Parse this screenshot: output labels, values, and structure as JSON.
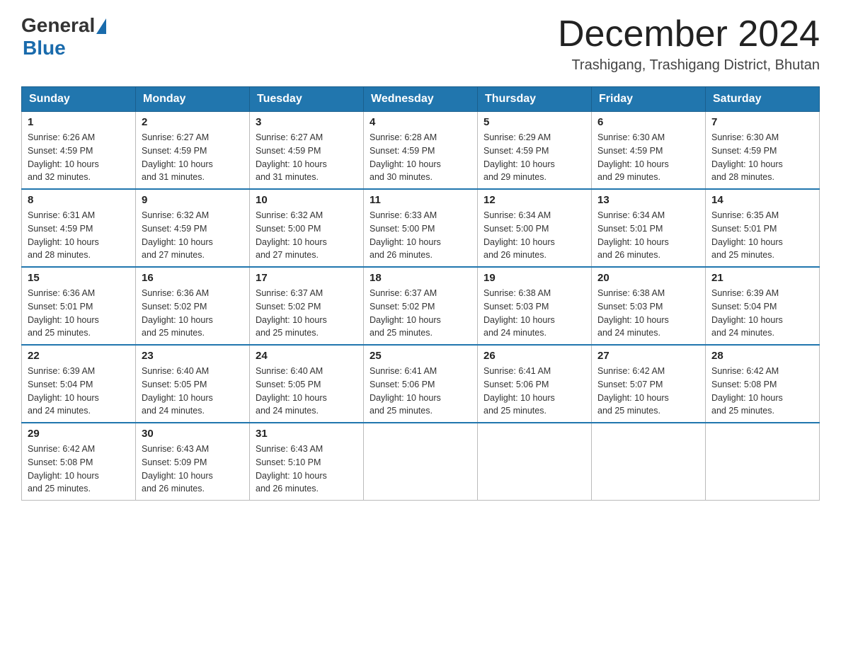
{
  "header": {
    "logo_general": "General",
    "logo_blue": "Blue",
    "month_year": "December 2024",
    "location": "Trashigang, Trashigang District, Bhutan"
  },
  "days_of_week": [
    "Sunday",
    "Monday",
    "Tuesday",
    "Wednesday",
    "Thursday",
    "Friday",
    "Saturday"
  ],
  "weeks": [
    [
      {
        "day": "1",
        "sunrise": "6:26 AM",
        "sunset": "4:59 PM",
        "daylight_hours": "10 hours",
        "daylight_minutes": "and 32 minutes."
      },
      {
        "day": "2",
        "sunrise": "6:27 AM",
        "sunset": "4:59 PM",
        "daylight_hours": "10 hours",
        "daylight_minutes": "and 31 minutes."
      },
      {
        "day": "3",
        "sunrise": "6:27 AM",
        "sunset": "4:59 PM",
        "daylight_hours": "10 hours",
        "daylight_minutes": "and 31 minutes."
      },
      {
        "day": "4",
        "sunrise": "6:28 AM",
        "sunset": "4:59 PM",
        "daylight_hours": "10 hours",
        "daylight_minutes": "and 30 minutes."
      },
      {
        "day": "5",
        "sunrise": "6:29 AM",
        "sunset": "4:59 PM",
        "daylight_hours": "10 hours",
        "daylight_minutes": "and 29 minutes."
      },
      {
        "day": "6",
        "sunrise": "6:30 AM",
        "sunset": "4:59 PM",
        "daylight_hours": "10 hours",
        "daylight_minutes": "and 29 minutes."
      },
      {
        "day": "7",
        "sunrise": "6:30 AM",
        "sunset": "4:59 PM",
        "daylight_hours": "10 hours",
        "daylight_minutes": "and 28 minutes."
      }
    ],
    [
      {
        "day": "8",
        "sunrise": "6:31 AM",
        "sunset": "4:59 PM",
        "daylight_hours": "10 hours",
        "daylight_minutes": "and 28 minutes."
      },
      {
        "day": "9",
        "sunrise": "6:32 AM",
        "sunset": "4:59 PM",
        "daylight_hours": "10 hours",
        "daylight_minutes": "and 27 minutes."
      },
      {
        "day": "10",
        "sunrise": "6:32 AM",
        "sunset": "5:00 PM",
        "daylight_hours": "10 hours",
        "daylight_minutes": "and 27 minutes."
      },
      {
        "day": "11",
        "sunrise": "6:33 AM",
        "sunset": "5:00 PM",
        "daylight_hours": "10 hours",
        "daylight_minutes": "and 26 minutes."
      },
      {
        "day": "12",
        "sunrise": "6:34 AM",
        "sunset": "5:00 PM",
        "daylight_hours": "10 hours",
        "daylight_minutes": "and 26 minutes."
      },
      {
        "day": "13",
        "sunrise": "6:34 AM",
        "sunset": "5:01 PM",
        "daylight_hours": "10 hours",
        "daylight_minutes": "and 26 minutes."
      },
      {
        "day": "14",
        "sunrise": "6:35 AM",
        "sunset": "5:01 PM",
        "daylight_hours": "10 hours",
        "daylight_minutes": "and 25 minutes."
      }
    ],
    [
      {
        "day": "15",
        "sunrise": "6:36 AM",
        "sunset": "5:01 PM",
        "daylight_hours": "10 hours",
        "daylight_minutes": "and 25 minutes."
      },
      {
        "day": "16",
        "sunrise": "6:36 AM",
        "sunset": "5:02 PM",
        "daylight_hours": "10 hours",
        "daylight_minutes": "and 25 minutes."
      },
      {
        "day": "17",
        "sunrise": "6:37 AM",
        "sunset": "5:02 PM",
        "daylight_hours": "10 hours",
        "daylight_minutes": "and 25 minutes."
      },
      {
        "day": "18",
        "sunrise": "6:37 AM",
        "sunset": "5:02 PM",
        "daylight_hours": "10 hours",
        "daylight_minutes": "and 25 minutes."
      },
      {
        "day": "19",
        "sunrise": "6:38 AM",
        "sunset": "5:03 PM",
        "daylight_hours": "10 hours",
        "daylight_minutes": "and 24 minutes."
      },
      {
        "day": "20",
        "sunrise": "6:38 AM",
        "sunset": "5:03 PM",
        "daylight_hours": "10 hours",
        "daylight_minutes": "and 24 minutes."
      },
      {
        "day": "21",
        "sunrise": "6:39 AM",
        "sunset": "5:04 PM",
        "daylight_hours": "10 hours",
        "daylight_minutes": "and 24 minutes."
      }
    ],
    [
      {
        "day": "22",
        "sunrise": "6:39 AM",
        "sunset": "5:04 PM",
        "daylight_hours": "10 hours",
        "daylight_minutes": "and 24 minutes."
      },
      {
        "day": "23",
        "sunrise": "6:40 AM",
        "sunset": "5:05 PM",
        "daylight_hours": "10 hours",
        "daylight_minutes": "and 24 minutes."
      },
      {
        "day": "24",
        "sunrise": "6:40 AM",
        "sunset": "5:05 PM",
        "daylight_hours": "10 hours",
        "daylight_minutes": "and 24 minutes."
      },
      {
        "day": "25",
        "sunrise": "6:41 AM",
        "sunset": "5:06 PM",
        "daylight_hours": "10 hours",
        "daylight_minutes": "and 25 minutes."
      },
      {
        "day": "26",
        "sunrise": "6:41 AM",
        "sunset": "5:06 PM",
        "daylight_hours": "10 hours",
        "daylight_minutes": "and 25 minutes."
      },
      {
        "day": "27",
        "sunrise": "6:42 AM",
        "sunset": "5:07 PM",
        "daylight_hours": "10 hours",
        "daylight_minutes": "and 25 minutes."
      },
      {
        "day": "28",
        "sunrise": "6:42 AM",
        "sunset": "5:08 PM",
        "daylight_hours": "10 hours",
        "daylight_minutes": "and 25 minutes."
      }
    ],
    [
      {
        "day": "29",
        "sunrise": "6:42 AM",
        "sunset": "5:08 PM",
        "daylight_hours": "10 hours",
        "daylight_minutes": "and 25 minutes."
      },
      {
        "day": "30",
        "sunrise": "6:43 AM",
        "sunset": "5:09 PM",
        "daylight_hours": "10 hours",
        "daylight_minutes": "and 26 minutes."
      },
      {
        "day": "31",
        "sunrise": "6:43 AM",
        "sunset": "5:10 PM",
        "daylight_hours": "10 hours",
        "daylight_minutes": "and 26 minutes."
      },
      null,
      null,
      null,
      null
    ]
  ]
}
